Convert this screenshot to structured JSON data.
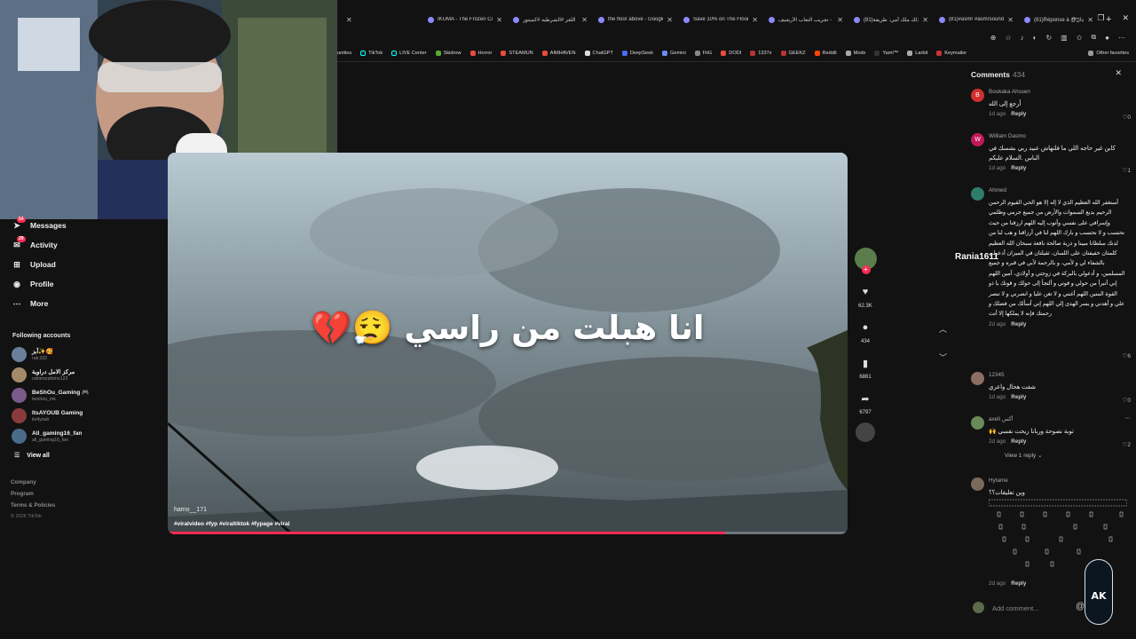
{
  "browser": {
    "tabs": [
      {
        "label": "IKUMA - The Frozen Cor..."
      },
      {
        "label": "اللغز #الشرطيه #كميتور"
      },
      {
        "label": "the floor above - Google"
      },
      {
        "label": "Save 10% on The Floor Al..."
      },
      {
        "label": "تجريب التعاب الأرشيف - ..."
      },
      {
        "label": "(81)ذلك ملك أمي: طريقة"
      },
      {
        "label": "(81)#asmr #asmrsounds"
      },
      {
        "label": "(81)Réponse à @برجان..."
      }
    ],
    "bookmarks": [
      "unities",
      "TikTok",
      "LIVE Center",
      "Skidrow",
      "Horror",
      "STEAMUN",
      "AIMHAVEN",
      "ChatGPT",
      "DeepSeek",
      "Gemini",
      "FitG",
      "DODI",
      "1337x",
      "GEEKZ",
      "Reddit",
      "Mods",
      "Yaml™",
      "Larbit",
      "Keymailer"
    ],
    "other_favorites": "Other favorites"
  },
  "sidebar": {
    "nav": [
      {
        "label": "Messages",
        "icon": "send-icon",
        "badge": "54"
      },
      {
        "label": "Activity",
        "icon": "inbox-icon",
        "badge": "29"
      },
      {
        "label": "Upload",
        "icon": "plus-square-icon",
        "badge": ""
      },
      {
        "label": "Profile",
        "icon": "profile-icon",
        "badge": ""
      },
      {
        "label": "More",
        "icon": "more-icon",
        "badge": ""
      }
    ],
    "following_title": "Following accounts",
    "accounts": [
      {
        "name": "آبز✨🥰",
        "handle": "rak.032",
        "color": "#6a7f9a"
      },
      {
        "name": "مركز الامل دراوية",
        "handle": "rahimorahimo123",
        "color": "#a58a6a"
      },
      {
        "name": "BeShOu_Gaming 🎮",
        "handle": "beshou_mk",
        "color": "#7a5a8a"
      },
      {
        "name": "ItsAYOUB Gaming",
        "handle": "its4youb",
        "color": "#8a3a3a"
      },
      {
        "name": "All_gaming16_fan",
        "handle": "all_gaming16_fan",
        "color": "#4a6a8a"
      }
    ],
    "view_all": "View all",
    "footer": [
      "Company",
      "Program",
      "Terms & Policies"
    ],
    "copyright": "© 2026 TikTok"
  },
  "video": {
    "caption": "انا هبلت من راسي 😮‍💨💔",
    "username": "hamo__171",
    "tags": "#viralvideo #fyp #viraltiktok #fypage #viral",
    "progress": 0.82
  },
  "actions": {
    "likes": "62.3K",
    "comments": "434",
    "saves": "6861",
    "shares": "6797"
  },
  "overlay_name": "Rania1611",
  "comments_panel": {
    "title": "Comments",
    "count": "434",
    "reply_label": "Reply",
    "items": [
      {
        "user": "Boukaka Ahssen",
        "text": "أرجع إلى الله",
        "time": "1d ago",
        "likes": "0",
        "avatar": "B",
        "color": "#d32f2f"
      },
      {
        "user": "William Dasmo",
        "text": "كاين غير حاجه اللي ما فلتهاش عبيد ربي بشسك في الباس .السلام عليكم",
        "time": "1d ago",
        "likes": "1",
        "avatar": "W",
        "color": "#c2185b"
      },
      {
        "user": "Ahmed",
        "text": "أستغفر الله العظيم الذي لا إله إلا هو الحي القيوم الرحمن الرحيم بديع السموات والأرض من جميع جرمي وظلمي وإسرافي على نفسي وأتوب إليه اللهم ارزقنا من حيث نحتسب و لا نحتسب و بارك اللهم لنا في أرزاقنا و هب لنا من لدنك سلطانا مبينا و ذرية صالحة نافعة سبحان الله العظيم كلمتان خفيفتان على اللسان، ثقيلتان في الميزان أدعولي بالشفاء لي و لأمي، و بالرحمة لأبي في قبره و جميع المسلمين، و أدعولي بالبركة في زوجتي و أولادي، آمين اللهم إني أتبرأ من حولي و قوتي و ألتجأ إلى حولك و قوتك يا ذو القوة المتين اللهم أغنني و لا تغن عليا و انصرني و لا تنصر علي و أهدني و يسر الهدى إلي اللهم إني أسألك من فضلك و رحمتك فإنه لا يملكها إلا أنت",
        "time": "2d ago",
        "likes": "6",
        "avatar": "",
        "color": "#2e7d6a"
      },
      {
        "user": "12345",
        "text": "شفت هحال واعري",
        "time": "1d ago",
        "likes": "0",
        "avatar": "",
        "color": "#8d6e63"
      },
      {
        "user": "axell أكس",
        "text": "توبة نصوحة وربانا ريحت نفسي 🙌",
        "time": "2d ago",
        "likes": "2",
        "avatar": "",
        "color": "#6a8a5a"
      },
      {
        "user": "Hytame",
        "text": "وين تعليقات؟؟",
        "time": "2d ago",
        "likes": "",
        "avatar": "",
        "color": "#7a6a5a"
      }
    ],
    "view_reply": "View 1 reply",
    "add_placeholder": "Add comment..."
  },
  "logo_text": "AK"
}
